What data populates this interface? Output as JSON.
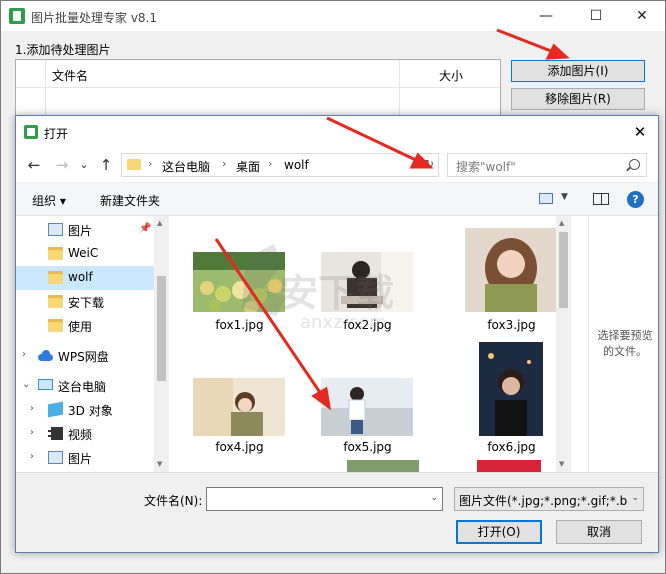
{
  "app": {
    "title": "图片批量处理专家 v8.1",
    "section_label": "1.添加待处理图片",
    "list_headers": {
      "name": "文件名",
      "size": "大小"
    },
    "add_button": "添加图片(I)",
    "remove_button": "移除图片(R)",
    "window_controls": {
      "minimize": "—",
      "maximize": "☐",
      "close": "✕"
    }
  },
  "dialog": {
    "title": "打开",
    "close": "✕",
    "nav": {
      "back": "←",
      "forward": "→",
      "dropdown": "⌄",
      "up": "↑"
    },
    "breadcrumb": [
      "这台电脑",
      "桌面",
      "wolf"
    ],
    "breadcrumb_sep": "›",
    "search_placeholder": "搜索\"wolf\"",
    "toolbar": {
      "organize": "组织 ▾",
      "new_folder": "新建文件夹",
      "help": "?"
    },
    "nav_pane": [
      {
        "label": "图片",
        "icon": "pictures-icon",
        "arrow": ""
      },
      {
        "label": "WeiC",
        "icon": "folder-icon",
        "arrow": ""
      },
      {
        "label": "wolf",
        "icon": "folder-icon",
        "arrow": ""
      },
      {
        "label": "安下载",
        "icon": "folder-icon",
        "arrow": ""
      },
      {
        "label": "使用",
        "icon": "folder-icon",
        "arrow": ""
      },
      {
        "label": "WPS网盘",
        "icon": "cloud-icon",
        "arrow": "›"
      },
      {
        "label": "这台电脑",
        "icon": "computer-icon",
        "arrow": "⌄"
      },
      {
        "label": "3D 对象",
        "icon": "3d-objects-icon",
        "arrow": "›"
      },
      {
        "label": "视频",
        "icon": "video-icon",
        "arrow": "›"
      },
      {
        "label": "图片",
        "icon": "pictures-icon",
        "arrow": "›"
      }
    ],
    "files": [
      "fox1.jpg",
      "fox2.jpg",
      "fox3.jpg",
      "fox4.jpg",
      "fox5.jpg",
      "fox6.jpg"
    ],
    "preview_text": "选择要预览的文件。",
    "filename_label": "文件名(N):",
    "filename_value": "",
    "filetype": "图片文件(*.jpg;*.png;*.gif;*.bn",
    "open_button": "打开(O)",
    "cancel_button": "取消"
  },
  "watermark": "anxz.com",
  "colors": {
    "accent": "#0078d7",
    "selected": "#cce8ff",
    "arrow": "#e8281e"
  }
}
